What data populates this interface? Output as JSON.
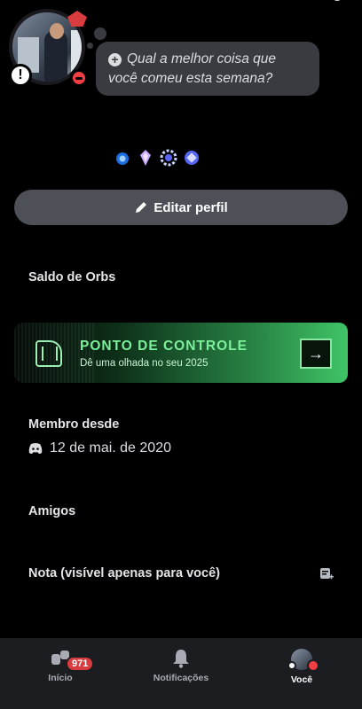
{
  "status": {
    "prompt": "Qual a melhor coisa que você comeu esta semana?"
  },
  "profile": {
    "edit_label": "Editar perfil",
    "orbs_label": "Saldo de Orbs",
    "member_since_label": "Membro desde",
    "member_since_date": "12 de mai. de 2020",
    "friends_label": "Amigos",
    "note_label": "Nota (visível apenas para você)"
  },
  "banner": {
    "title": "PONTO DE CONTROLE",
    "subtitle": "Dê uma olhada no seu 2025"
  },
  "badges": [
    "hypesquad-icon",
    "nitro-gem-icon",
    "boost-icon",
    "quest-icon"
  ],
  "nav": {
    "home_label": "Início",
    "home_count": "971",
    "notifications_label": "Notificações",
    "you_label": "Você"
  },
  "colors": {
    "background": "#000000",
    "bubble": "#3a3b41",
    "button": "#4e5058",
    "accent_green": "#3fc466",
    "badge_red": "#d83c3e",
    "nav_bg": "#1c1d21"
  }
}
